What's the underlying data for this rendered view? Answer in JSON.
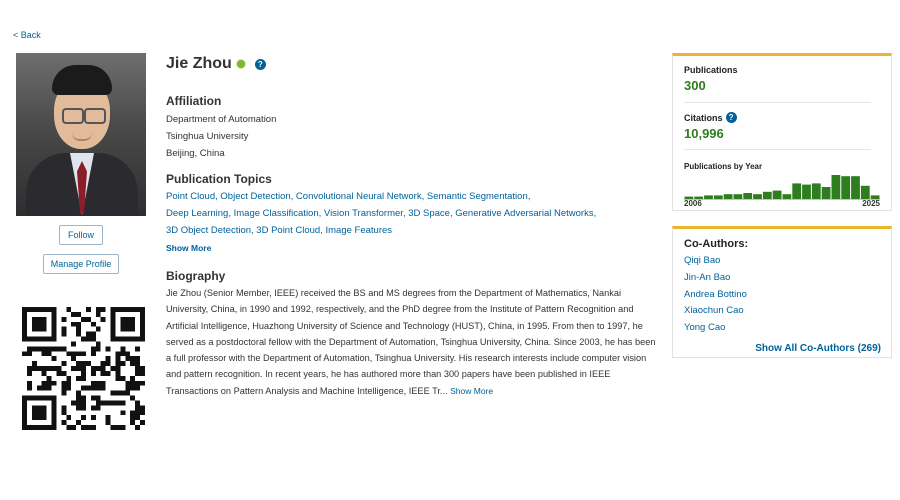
{
  "nav": {
    "back": "< Back"
  },
  "profile": {
    "name": "Jie Zhou",
    "help_icon": "?",
    "follow": "Follow",
    "manage": "Manage Profile"
  },
  "affiliation": {
    "heading": "Affiliation",
    "lines": [
      "Department of Automation",
      "Tsinghua University",
      "Beijing, China"
    ]
  },
  "topics": {
    "heading": "Publication Topics",
    "items": [
      "Point Cloud",
      "Object Detection",
      "Convolutional Neural Network",
      "Semantic Segmentation",
      "Deep Learning",
      "Image Classification",
      "Vision Transformer",
      "3D Space",
      "Generative Adversarial Networks",
      "3D Object Detection",
      "3D Point Cloud",
      "Image Features"
    ],
    "show_more": "Show More"
  },
  "biography": {
    "heading": "Biography",
    "text": "Jie Zhou (Senior Member, IEEE) received the BS and MS degrees from the Department of Mathematics, Nankai University, China, in 1990 and 1992, respectively, and the PhD degree from the Institute of Pattern Recognition and Artificial Intelligence, Huazhong University of Science and Technology (HUST), China, in 1995. From then to 1997, he served as a postdoctoral fellow with the Department of Automation, Tsinghua University, China. Since 2003, he has been a full professor with the Department of Automation, Tsinghua University. His research interests include computer vision and pattern recognition. In recent years, he has authored more than 300 papers have been published in IEEE Transactions on Pattern Analysis and Machine Intelligence, IEEE Tr...",
    "show_more": "Show More"
  },
  "stats": {
    "publications_label": "Publications",
    "publications_value": "300",
    "citations_label": "Citations",
    "citations_value": "10,996",
    "by_year_label": "Publications by Year",
    "year_start": "2006",
    "year_end": "2025"
  },
  "chart_data": {
    "type": "bar",
    "categories": [
      "2006",
      "2007",
      "2008",
      "2009",
      "2010",
      "2011",
      "2012",
      "2013",
      "2014",
      "2015",
      "2016",
      "2017",
      "2018",
      "2019",
      "2020",
      "2021",
      "2022",
      "2023",
      "2024",
      "2025"
    ],
    "values": [
      2,
      2,
      3,
      3,
      4,
      4,
      5,
      4,
      6,
      7,
      4,
      13,
      12,
      13,
      10,
      20,
      19,
      19,
      11,
      3
    ],
    "title": "Publications by Year",
    "xlabel": "",
    "ylabel": "",
    "grid": false,
    "color": "#2e7d1f"
  },
  "coauthors": {
    "heading": "Co-Authors:",
    "names": [
      "Qiqi Bao",
      "Jin-An Bao",
      "Andrea Bottino",
      "Xiaochun Cao",
      "Yong Cao"
    ],
    "show_all": "Show All Co-Authors (269)"
  },
  "colors": {
    "link": "#00629b",
    "accent": "#e7b732",
    "stat": "#2e7d1f"
  }
}
